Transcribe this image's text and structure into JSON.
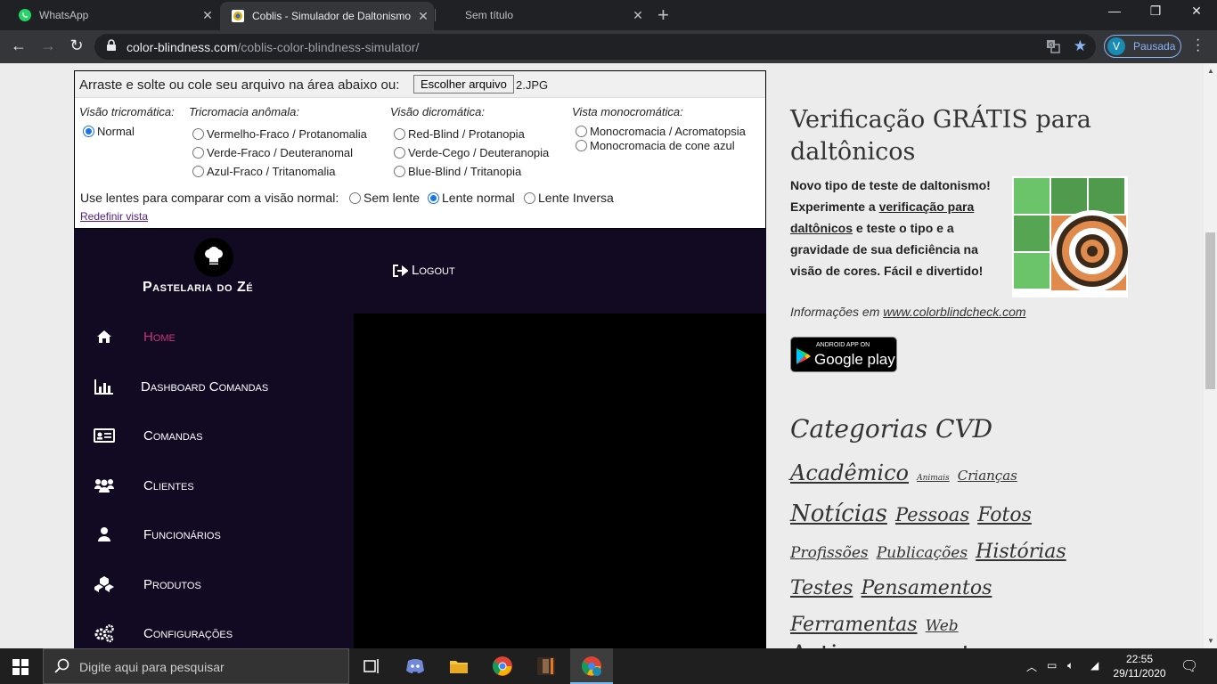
{
  "browser": {
    "tabs": [
      {
        "title": "WhatsApp"
      },
      {
        "title": "Coblis - Simulador de Daltonismo"
      },
      {
        "title": "Sem título"
      }
    ],
    "url_domain": "color-blindness.com",
    "url_path": "/coblis-color-blindness-simulator/",
    "profile_initial": "V",
    "profile_label": "Pausada"
  },
  "simulator": {
    "upload_label": "Arraste e solte ou cole seu arquivo na área abaixo ou:",
    "file_button": "Escolher arquivo",
    "file_name": "2.JPG",
    "groups": {
      "tri": "Visão tricromática:",
      "anom": "Tricromacia anômala:",
      "di": "Visão dicromática:",
      "mono": "Vista monocromática:"
    },
    "options": {
      "normal": "Normal",
      "protanomalia": "Vermelho-Fraco / Protanomalia",
      "deuteranomal": "Verde-Fraco / Deuteranomal",
      "tritanomalia": "Azul-Fraco / Tritanomalia",
      "protanopia": "Red-Blind / Protanopia",
      "deuteranopia": "Verde-Cego / Deuteranopia",
      "tritanopia": "Blue-Blind / Tritanopia",
      "acromatopsia": "Monocromacia / Acromatopsia",
      "cone_azul": "Monocromacia de cone azul"
    },
    "selected_vision": "normal",
    "lens_label": "Use lentes para comparar com a visão normal:",
    "lens_options": {
      "none": "Sem lente",
      "normal": "Lente normal",
      "inverse": "Lente Inversa"
    },
    "selected_lens": "normal",
    "reset_link": "Redefinir vista"
  },
  "app": {
    "brand": "Pastelaria do Zé",
    "logout": "Logout",
    "nav": [
      {
        "label": "Home",
        "icon": "home-icon",
        "active": true
      },
      {
        "label": "Dashboard Comandas",
        "icon": "bar-chart-icon",
        "active": false
      },
      {
        "label": "Comandas",
        "icon": "id-card-icon",
        "active": false
      },
      {
        "label": "Clientes",
        "icon": "users-icon",
        "active": false
      },
      {
        "label": "Funcionários",
        "icon": "user-icon",
        "active": false
      },
      {
        "label": "Produtos",
        "icon": "cubes-icon",
        "active": false
      },
      {
        "label": "Configurações",
        "icon": "cogs-icon",
        "active": false
      }
    ],
    "colors": {
      "background": "#120a23",
      "active": "#c8327b"
    }
  },
  "sidebar": {
    "title": "Verificação GRÁTIS para daltônicos",
    "desc_1": "Novo tipo de teste de daltonismo! Experimente a",
    "desc_link": "verificação para daltônicos",
    "desc_2": "e teste o tipo e a gravidade de sua deficiência na visão de cores. Fácil e divertido!",
    "info_prefix": "Informações em",
    "info_link": "www.colorblindcheck.com",
    "gplay_small": "ANDROID APP ON",
    "gplay_big": "Google play",
    "categories_title": "Categorias CVD",
    "categories": [
      "Acadêmico",
      "Animais",
      "Crianças",
      "Notícias",
      "Pessoas",
      "Fotos",
      "Profissões",
      "Publicações",
      "Histórias",
      "Testes",
      "Pensamentos",
      "Ferramentas",
      "Web"
    ],
    "cut_heading": "Artigos recentes"
  },
  "taskbar": {
    "search_placeholder": "Digite aqui para pesquisar",
    "time": "22:55",
    "date": "29/11/2020"
  }
}
